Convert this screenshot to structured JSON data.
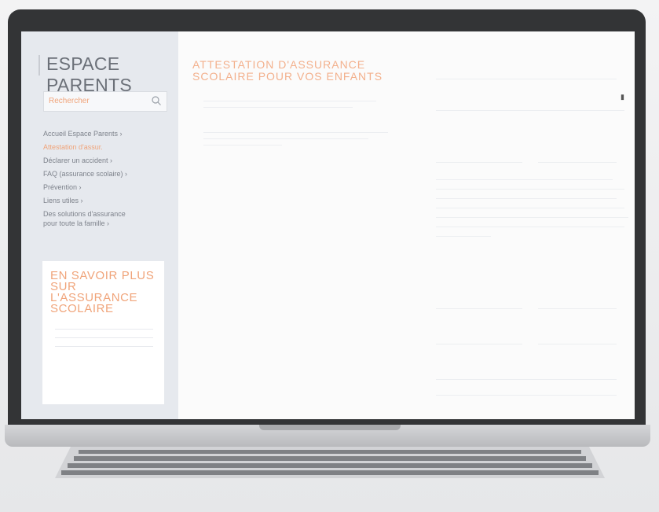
{
  "sidebar": {
    "logo": "ESPACE PARENTS",
    "search_placeholder": "Rechercher",
    "nav": [
      {
        "label": "Accueil Espace Parents  ›",
        "active": false
      },
      {
        "label": "Attestation d'assur.",
        "active": true
      },
      {
        "label": "Déclarer un accident  ›",
        "active": false
      },
      {
        "label": "FAQ (assurance scolaire)  ›",
        "active": false
      },
      {
        "label": "Prévention  ›",
        "active": false
      },
      {
        "label": "Liens utiles  ›",
        "active": false
      },
      {
        "label": "Des solutions d'assurance\npour toute la famille  ›",
        "active": false
      }
    ],
    "promo": {
      "title": "EN SAVOIR PLUS\nSUR\nL'ASSURANCE\nSCOLAIRE",
      "link": ""
    }
  },
  "main": {
    "title": "ATTESTATION D'ASSURANCE\nSCOLAIRE POUR VOS ENFANTS"
  },
  "form": {
    "field1": "",
    "select": "",
    "select_marker": "▮",
    "section1": "",
    "field_left": "",
    "field_right": "",
    "section2": "",
    "f_a": "",
    "f_b": "",
    "f_c": "",
    "f_d": "",
    "f_e": "",
    "f_f": ""
  },
  "colors": {
    "accent": "#f0a47a",
    "sidebar_bg": "#e6e9ee",
    "frame": "#333436"
  }
}
